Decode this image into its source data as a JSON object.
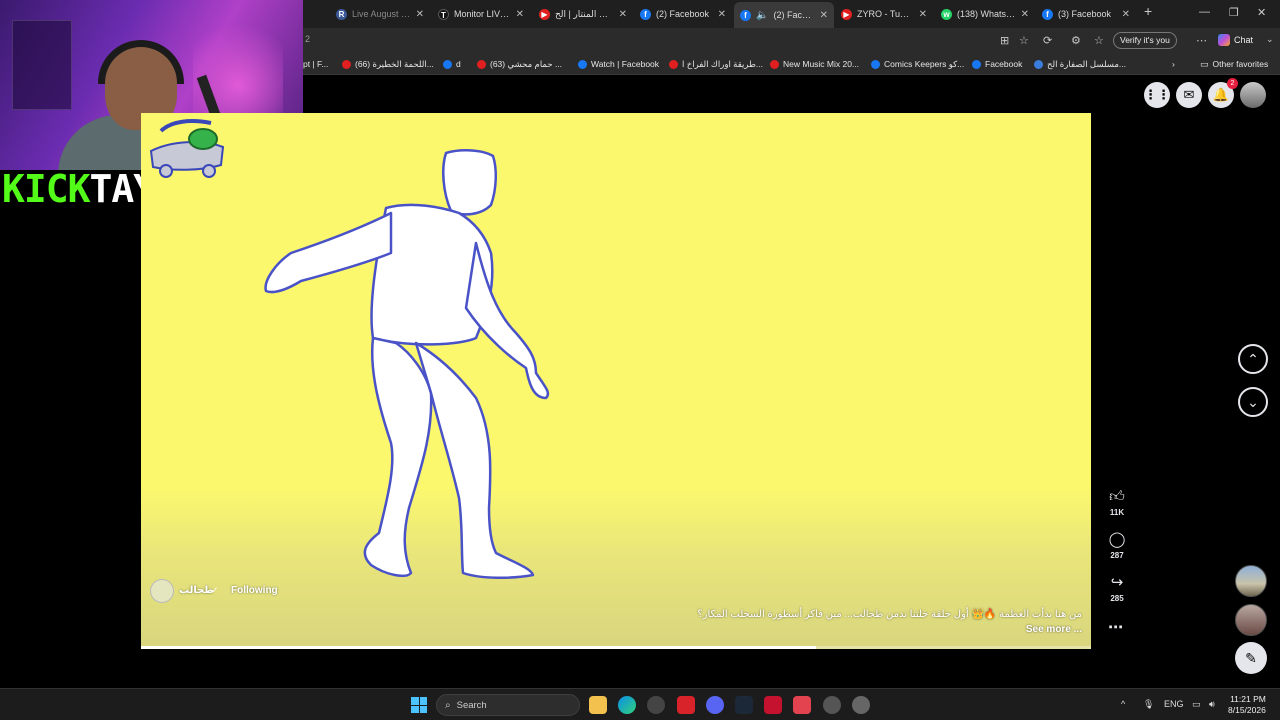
{
  "browser": {
    "tabs": [
      {
        "title": "Live August 08 -",
        "favicon": "R",
        "color": "#3b5998",
        "active": false
      },
      {
        "title": "Monitor LIVE | Tik",
        "favicon": "T",
        "color": "#000000",
        "active": false
      },
      {
        "title": "السيت المنتار | الح",
        "favicon": "▶",
        "color": "#e02020",
        "active": false
      },
      {
        "title": "(2) Facebook",
        "favicon": "f",
        "color": "#1877f2",
        "active": false
      },
      {
        "title": "(2) Facebook",
        "favicon": "f",
        "color": "#1877f2",
        "active": true
      },
      {
        "title": "ZYRO - Tuma Nu",
        "favicon": "▶",
        "color": "#e02020",
        "active": false
      },
      {
        "title": "(138) WhatsApp",
        "favicon": "w",
        "color": "#25d366",
        "active": false
      },
      {
        "title": "(3) Facebook",
        "favicon": "f",
        "color": "#1877f2",
        "active": false
      }
    ],
    "url_fragment": "2",
    "verify_label": "Verify it's you",
    "chat_label": "Chat",
    "bookmarks": [
      {
        "label": "pt | F...",
        "type": "misc"
      },
      {
        "label": "(66) اللحمة الخطيرة...",
        "type": "yt"
      },
      {
        "label": "d",
        "type": "fb"
      },
      {
        "label": "(63) حمام محشي ...",
        "type": "yt"
      },
      {
        "label": "Watch | Facebook",
        "type": "fb"
      },
      {
        "label": "طريقة اوراك الفراخ ا...",
        "type": "yt"
      },
      {
        "label": "New Music Mix 20...",
        "type": "yt"
      },
      {
        "label": "Comics Keepers كو...",
        "type": "fb"
      },
      {
        "label": "Facebook",
        "type": "fb"
      },
      {
        "label": "مسلسل الصفارة الح...",
        "type": "misc"
      }
    ],
    "other_favorites": "Other favorites"
  },
  "overlay": {
    "kick_green": "KICK",
    "kick_white": "TAYYEEL"
  },
  "facebook": {
    "notif_count": "2",
    "video": {
      "page_name": "طحالب",
      "following_label": "Following",
      "caption": "من هنا بدأت العظمة 🔥👑 أول حلقة خلتنا ندمن طحالب... مين فاكر أسطورة السجلب المكار؟",
      "see_more": "See more ...",
      "progress": 0.71,
      "bg_color": "#fbf86e"
    },
    "actions": {
      "likes": "11K",
      "comments": "287",
      "shares": "285"
    }
  },
  "taskbar": {
    "search_placeholder": "Search",
    "lang": "ENG",
    "time": "11:21 PM",
    "date": "8/15/2026"
  }
}
